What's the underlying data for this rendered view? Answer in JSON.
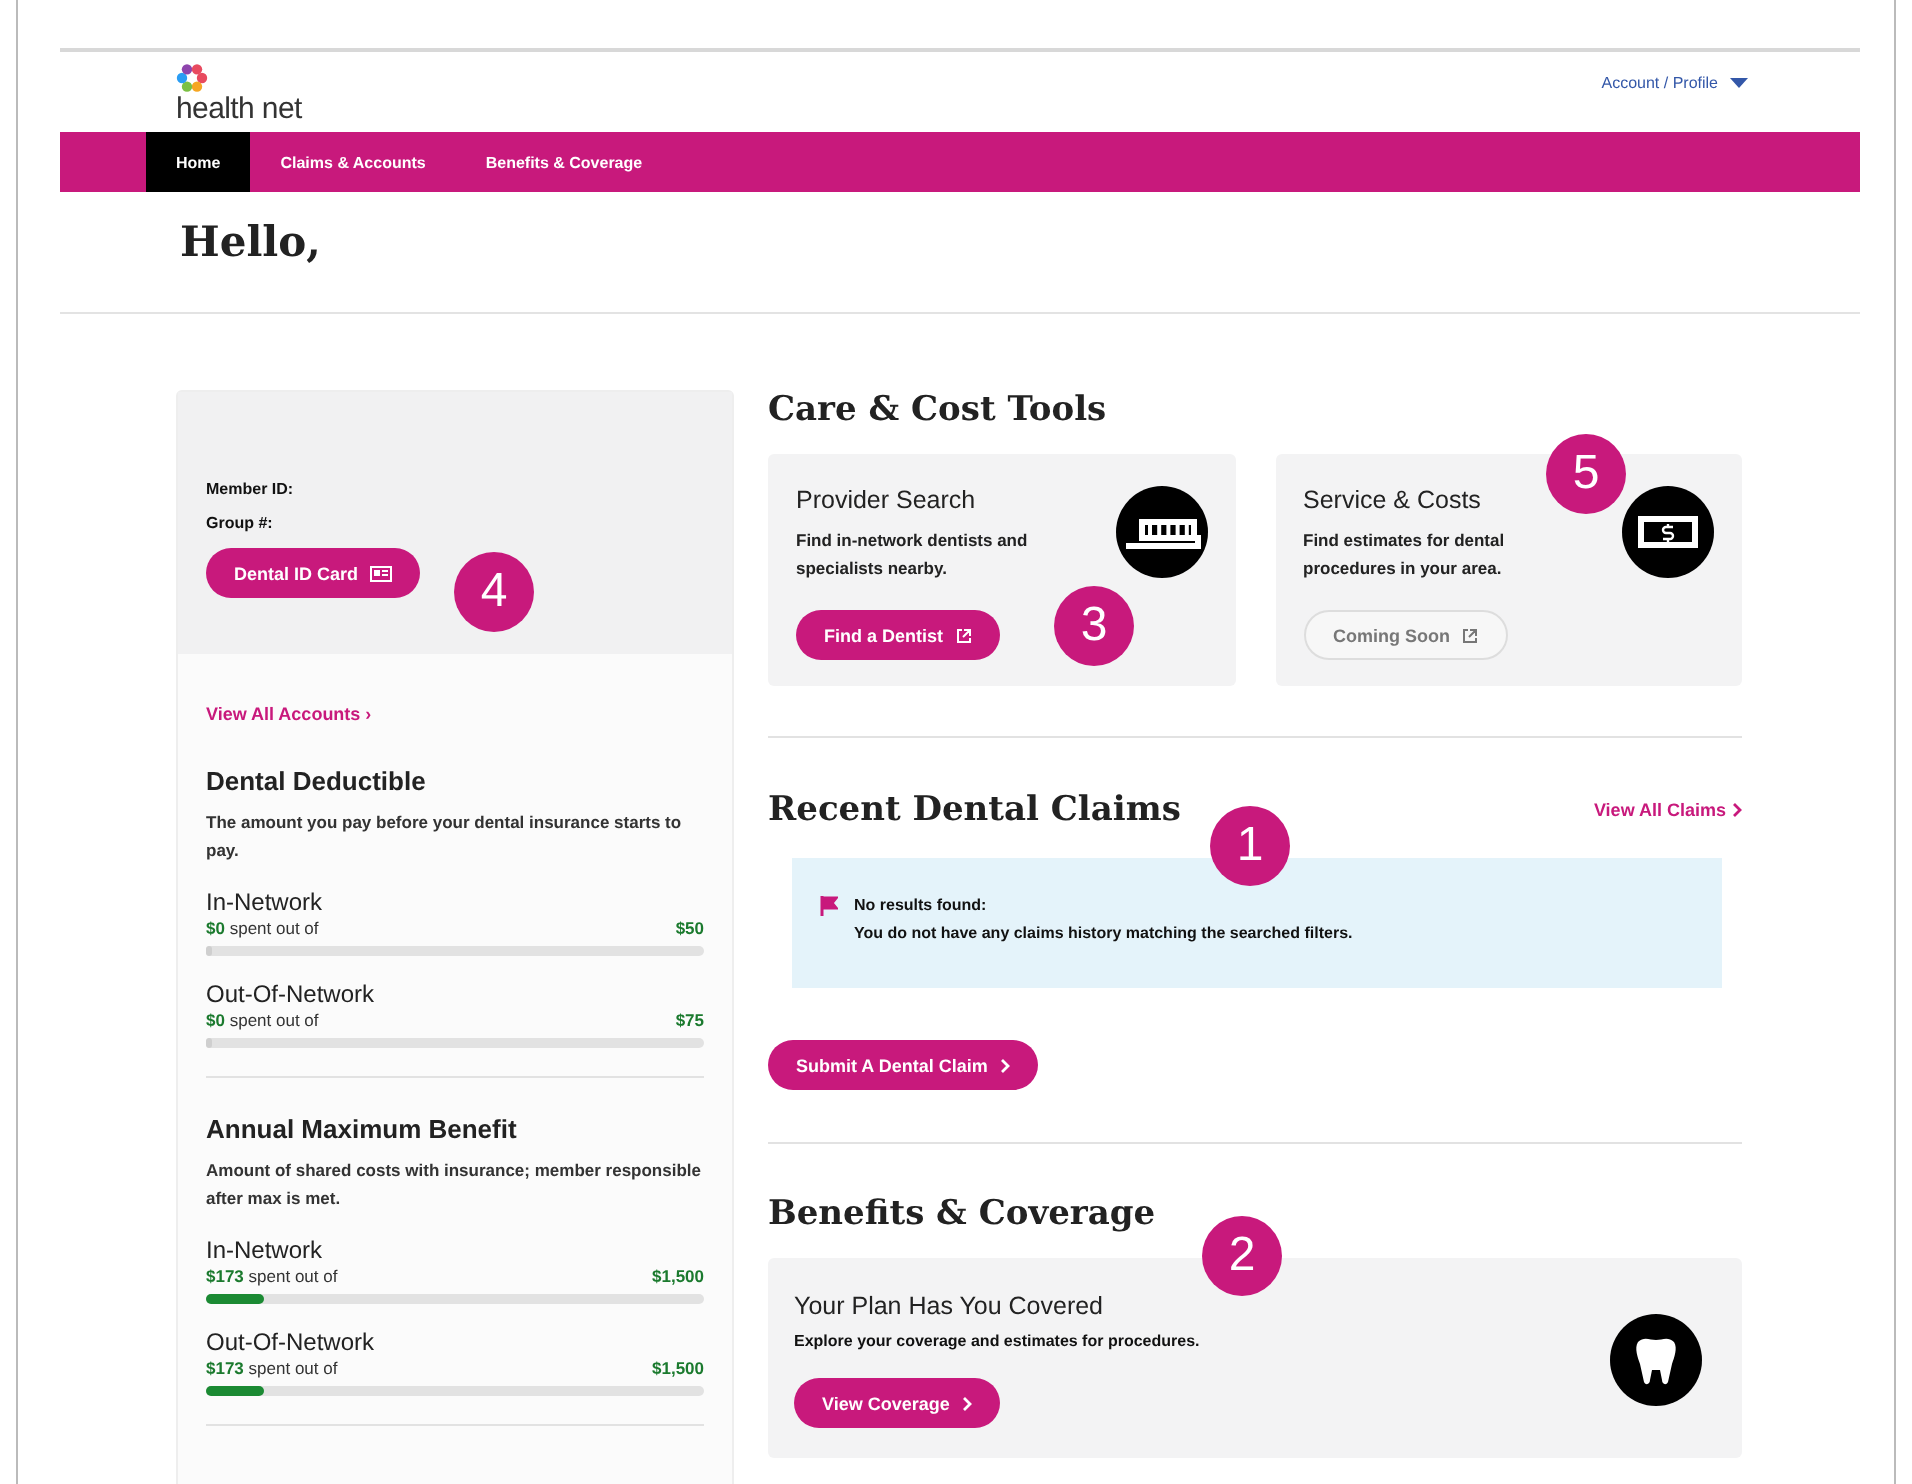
{
  "header": {
    "logo_text": "health net",
    "account_menu": "Account / Profile"
  },
  "nav": [
    {
      "label": "Home",
      "selected": true
    },
    {
      "label": "Claims & Accounts",
      "selected": false
    },
    {
      "label": "Benefits & Coverage",
      "selected": false
    }
  ],
  "greeting": "Hello,",
  "member_card": {
    "member_id_label": "Member ID:",
    "group_label": "Group #:",
    "id_card_button": "Dental ID Card",
    "accounts_link": "View All Accounts ›"
  },
  "benefit_sections": [
    {
      "title": "Dental Deductible",
      "description": "The amount you pay before your dental insurance starts to pay.",
      "meters": [
        {
          "name": "In-Network",
          "spent": "$0",
          "spent_text": "spent out of",
          "total": "$50",
          "level": 0
        },
        {
          "name": "Out-Of-Network",
          "spent": "$0",
          "spent_text": "spent out of",
          "total": "$75",
          "level": 0
        }
      ]
    },
    {
      "title": "Annual Maximum Benefit",
      "description": "Amount of shared costs with insurance; member responsible after max is met.",
      "meters": [
        {
          "name": "In-Network",
          "spent": "$173",
          "spent_text": "spent out of",
          "total": "$1,500",
          "level": 0.115
        },
        {
          "name": "Out-Of-Network",
          "spent": "$173",
          "spent_text": "spent out of",
          "total": "$1,500",
          "level": 0.115
        }
      ]
    }
  ],
  "care_tools": {
    "title": "Care & Cost Tools",
    "cards": [
      {
        "kind": "toothbrush",
        "title": "Provider Search",
        "description": "Find in-network dentists and specialists nearby.",
        "button": "Find a Dentist",
        "disabled": false
      },
      {
        "kind": "money",
        "title": "Service & Costs",
        "description": "Find estimates for dental procedures in your area.",
        "button": "Coming Soon",
        "disabled": true
      }
    ]
  },
  "claims": {
    "title": "Recent Dental Claims",
    "view_all": "View All Claims",
    "notice_title": "No results found:",
    "notice_text": "You do not have any claims history matching the searched filters.",
    "submit_button": "Submit A Dental Claim"
  },
  "coverage": {
    "title": "Benefits & Coverage",
    "card_title": "Your Plan Has You Covered",
    "card_text": "Explore your coverage and estimates for procedures.",
    "button": "View Coverage"
  },
  "callouts": [
    "1",
    "2",
    "3",
    "4",
    "5"
  ]
}
